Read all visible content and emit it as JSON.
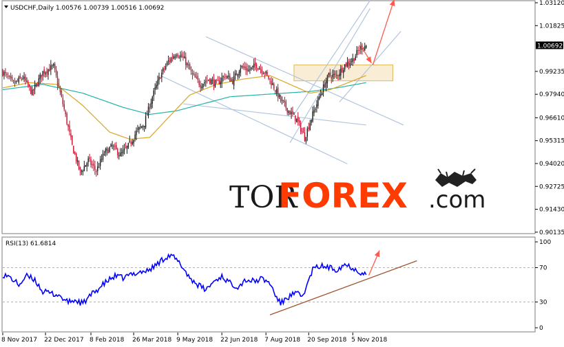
{
  "window": {
    "price_title": "USDCHF,Daily  1.00576 1.00739 1.00516 1.00692",
    "rsi_title": "RSI(13) 61.6814"
  },
  "logo": {
    "part1": "TOR",
    "part2": "FOREX",
    "part3": ".com"
  },
  "colors": {
    "bull": "#1a1a1a",
    "bear": "#c8102e",
    "ma_fast": "#daa520",
    "ma_slow": "#20b2aa",
    "channel": "#b0c4de",
    "rsi": "#0000ff",
    "rsi_trend": "#a0522d",
    "arrow": "#ff5a4a",
    "zone": "#f5deb3",
    "last_price_bg": "#000000"
  },
  "chart_data": [
    {
      "type": "candlestick",
      "title": "USDCHF,Daily",
      "ohlc_last": {
        "open": 1.00576,
        "high": 1.00739,
        "low": 1.00516,
        "close": 1.00692
      },
      "last_price_label": "1.00692",
      "y_ticks": [
        "1.03120",
        "1.01825",
        "0.99235",
        "0.97940",
        "0.96610",
        "0.95315",
        "0.94020",
        "0.92725",
        "0.91430",
        "0.90135"
      ],
      "ylim": [
        0.9013,
        1.0312
      ],
      "x_ticks": [
        "8 Nov 2017",
        "22 Dec 2017",
        "8 Feb 2018",
        "26 Mar 2018",
        "9 May 2018",
        "22 Jun 2018",
        "7 Aug 2018",
        "20 Sep 2018",
        "5 Nov 2018"
      ],
      "x_tick_index": [
        0,
        32,
        66,
        98,
        131,
        164,
        197,
        229,
        262
      ],
      "anchors_close": [
        [
          0,
          0.992
        ],
        [
          8,
          0.985
        ],
        [
          15,
          0.989
        ],
        [
          22,
          0.98
        ],
        [
          30,
          0.992
        ],
        [
          38,
          0.995
        ],
        [
          45,
          0.974
        ],
        [
          52,
          0.95
        ],
        [
          58,
          0.935
        ],
        [
          64,
          0.942
        ],
        [
          70,
          0.936
        ],
        [
          76,
          0.946
        ],
        [
          82,
          0.95
        ],
        [
          88,
          0.945
        ],
        [
          94,
          0.95
        ],
        [
          100,
          0.958
        ],
        [
          106,
          0.963
        ],
        [
          112,
          0.978
        ],
        [
          118,
          0.99
        ],
        [
          124,
          0.998
        ],
        [
          130,
          1.003
        ],
        [
          136,
          0.999
        ],
        [
          142,
          0.99
        ],
        [
          148,
          0.985
        ],
        [
          154,
          0.988
        ],
        [
          160,
          0.985
        ],
        [
          166,
          0.99
        ],
        [
          172,
          0.987
        ],
        [
          178,
          0.995
        ],
        [
          184,
          0.993
        ],
        [
          190,
          0.996
        ],
        [
          196,
          0.992
        ],
        [
          202,
          0.985
        ],
        [
          208,
          0.976
        ],
        [
          214,
          0.97
        ],
        [
          220,
          0.965
        ],
        [
          226,
          0.955
        ],
        [
          232,
          0.968
        ],
        [
          238,
          0.98
        ],
        [
          244,
          0.99
        ],
        [
          250,
          0.99
        ],
        [
          256,
          0.996
        ],
        [
          262,
          0.999
        ],
        [
          268,
          1.006
        ],
        [
          272,
          1.007
        ]
      ],
      "ma_fast_anchors": [
        [
          0,
          0.983
        ],
        [
          20,
          0.986
        ],
        [
          40,
          0.985
        ],
        [
          60,
          0.973
        ],
        [
          80,
          0.958
        ],
        [
          95,
          0.954
        ],
        [
          110,
          0.955
        ],
        [
          125,
          0.967
        ],
        [
          140,
          0.979
        ],
        [
          160,
          0.985
        ],
        [
          180,
          0.988
        ],
        [
          200,
          0.99
        ],
        [
          215,
          0.985
        ],
        [
          230,
          0.98
        ],
        [
          245,
          0.982
        ],
        [
          262,
          0.987
        ],
        [
          272,
          0.99
        ]
      ],
      "ma_slow_anchors": [
        [
          0,
          0.982
        ],
        [
          30,
          0.985
        ],
        [
          60,
          0.98
        ],
        [
          90,
          0.972
        ],
        [
          110,
          0.968
        ],
        [
          130,
          0.97
        ],
        [
          150,
          0.974
        ],
        [
          170,
          0.978
        ],
        [
          190,
          0.979
        ],
        [
          210,
          0.98
        ],
        [
          230,
          0.981
        ],
        [
          250,
          0.983
        ],
        [
          272,
          0.986
        ]
      ],
      "lines": [
        {
          "kind": "channel",
          "x1": 118,
          "y1": 0.99,
          "x2": 258,
          "y2": 0.94
        },
        {
          "kind": "channel",
          "x1": 152,
          "y1": 1.012,
          "x2": 300,
          "y2": 0.962
        },
        {
          "kind": "channel",
          "x1": 135,
          "y1": 0.974,
          "x2": 272,
          "y2": 0.962
        },
        {
          "kind": "channel",
          "x1": 215,
          "y1": 0.952,
          "x2": 275,
          "y2": 1.028
        },
        {
          "kind": "channel",
          "x1": 218,
          "y1": 0.968,
          "x2": 278,
          "y2": 1.036
        },
        {
          "kind": "channel",
          "x1": 252,
          "y1": 0.975,
          "x2": 298,
          "y2": 1.015
        }
      ],
      "zone": {
        "x1": 218,
        "x2": 292,
        "y_top": 0.996,
        "y_bottom": 0.987
      },
      "arrows": [
        {
          "x1": 268,
          "y1": 1.007,
          "x2": 276,
          "y2": 0.997
        },
        {
          "x1": 277,
          "y1": 0.996,
          "x2": 293,
          "y2": 1.033
        }
      ]
    },
    {
      "type": "line",
      "title": "RSI(13)",
      "value": 61.6814,
      "y_ticks": [
        "100",
        "70",
        "30",
        "0"
      ],
      "ylim": [
        0,
        100
      ],
      "anchors": [
        [
          0,
          62
        ],
        [
          6,
          58
        ],
        [
          12,
          50
        ],
        [
          18,
          60
        ],
        [
          24,
          56
        ],
        [
          30,
          42
        ],
        [
          36,
          40
        ],
        [
          42,
          38
        ],
        [
          48,
          30
        ],
        [
          54,
          32
        ],
        [
          60,
          28
        ],
        [
          66,
          38
        ],
        [
          72,
          46
        ],
        [
          78,
          54
        ],
        [
          84,
          60
        ],
        [
          90,
          58
        ],
        [
          96,
          62
        ],
        [
          102,
          65
        ],
        [
          108,
          66
        ],
        [
          114,
          72
        ],
        [
          120,
          80
        ],
        [
          124,
          84
        ],
        [
          128,
          82
        ],
        [
          134,
          72
        ],
        [
          140,
          58
        ],
        [
          146,
          50
        ],
        [
          152,
          44
        ],
        [
          158,
          54
        ],
        [
          164,
          60
        ],
        [
          170,
          52
        ],
        [
          176,
          48
        ],
        [
          182,
          56
        ],
        [
          188,
          54
        ],
        [
          194,
          57
        ],
        [
          200,
          52
        ],
        [
          204,
          38
        ],
        [
          208,
          28
        ],
        [
          212,
          34
        ],
        [
          216,
          38
        ],
        [
          220,
          40
        ],
        [
          224,
          36
        ],
        [
          228,
          50
        ],
        [
          232,
          68
        ],
        [
          238,
          72
        ],
        [
          244,
          70
        ],
        [
          250,
          68
        ],
        [
          256,
          74
        ],
        [
          262,
          70
        ],
        [
          266,
          66
        ],
        [
          272,
          62
        ]
      ],
      "trendline": {
        "x1": 200,
        "y1": 15,
        "x2": 310,
        "y2": 78
      },
      "arrow": {
        "x1": 274,
        "y1": 61,
        "x2": 282,
        "y2": 90
      }
    }
  ]
}
